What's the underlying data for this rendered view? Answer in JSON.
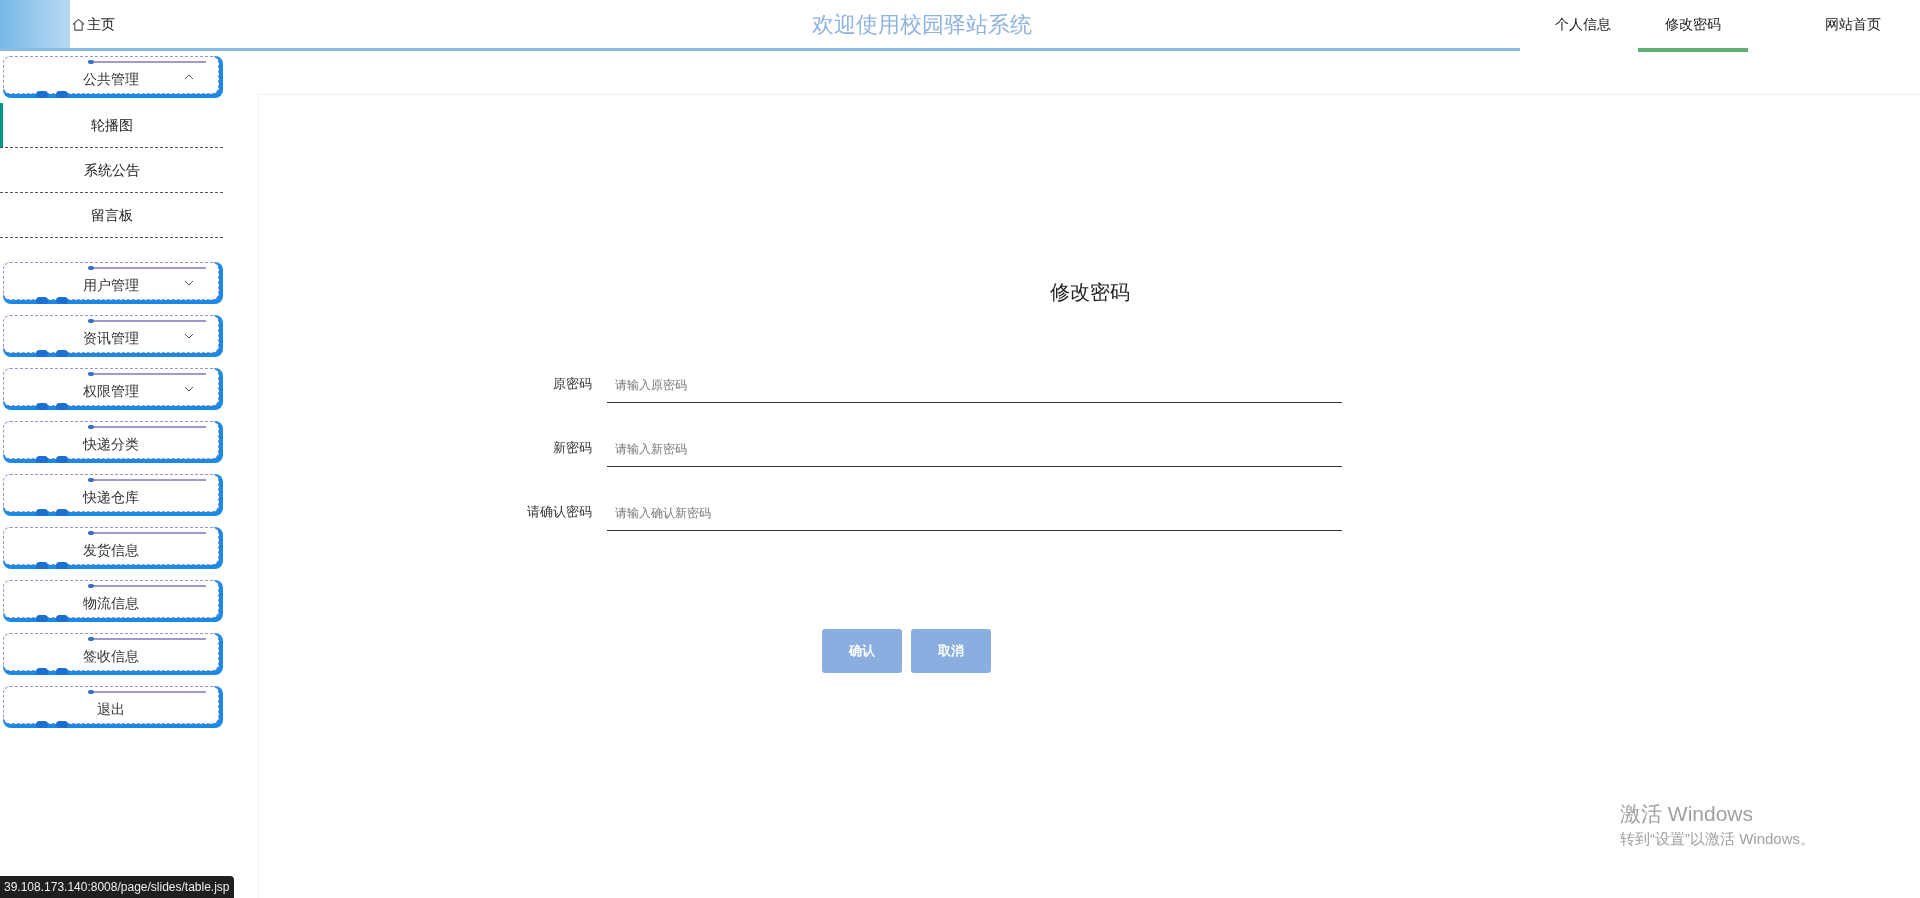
{
  "header": {
    "home_link": "主页",
    "title": "欢迎使用校园驿站系统",
    "nav": [
      {
        "label": "个人信息",
        "selected": false
      },
      {
        "label": "修改密码",
        "selected": true
      },
      {
        "label": "网站首页",
        "selected": false
      }
    ]
  },
  "sidebar": {
    "groups": [
      {
        "label": "公共管理",
        "expanded": true,
        "children": [
          {
            "label": "轮播图",
            "selected": true
          },
          {
            "label": "系统公告",
            "selected": false
          },
          {
            "label": "留言板",
            "selected": false
          }
        ]
      },
      {
        "label": "用户管理",
        "expanded": false
      },
      {
        "label": "资讯管理",
        "expanded": false
      },
      {
        "label": "权限管理",
        "expanded": false
      },
      {
        "label": "快递分类"
      },
      {
        "label": "快递仓库"
      },
      {
        "label": "发货信息"
      },
      {
        "label": "物流信息"
      },
      {
        "label": "签收信息"
      },
      {
        "label": "退出"
      }
    ]
  },
  "form": {
    "title": "修改密码",
    "fields": [
      {
        "label": "原密码",
        "placeholder": "请输入原密码"
      },
      {
        "label": "新密码",
        "placeholder": "请输入新密码"
      },
      {
        "label": "请确认密码",
        "placeholder": "请输入确认新密码"
      }
    ],
    "buttons": [
      "确认",
      "取消"
    ]
  },
  "os_notice": {
    "title": "激活 Windows",
    "text": "转到“设置”以激活 Windows。"
  },
  "status_url": "39.108.173.140:8008/page/slides/table.jsp"
}
